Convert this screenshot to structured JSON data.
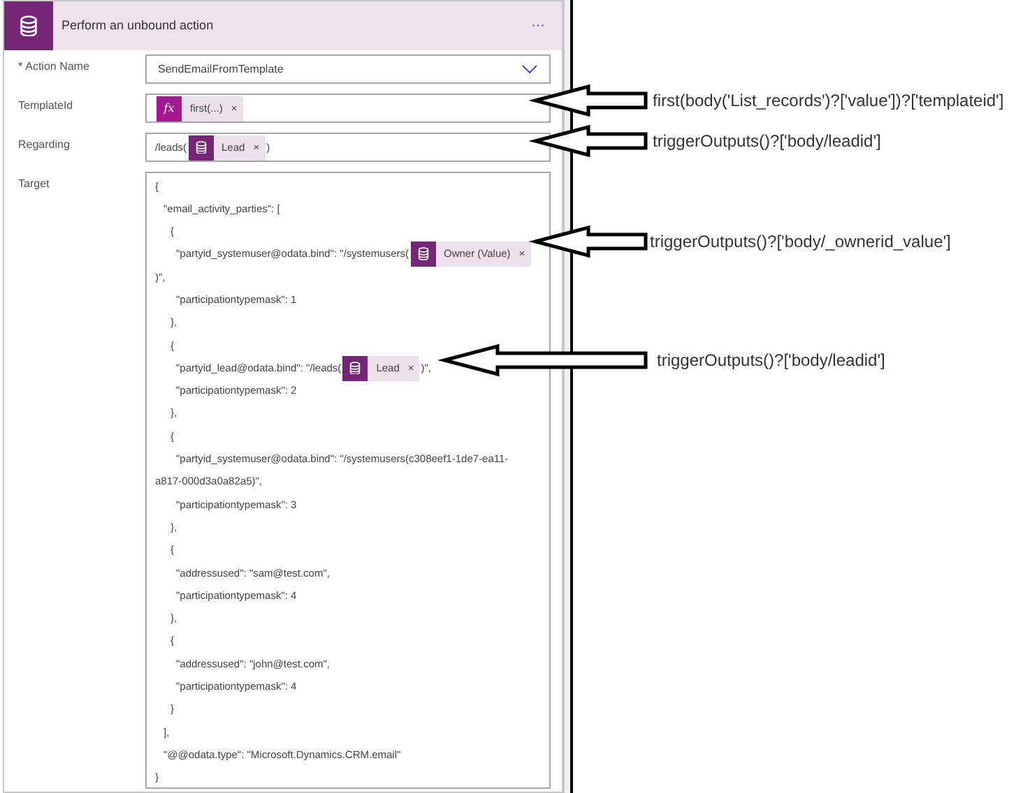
{
  "card": {
    "title": "Perform an unbound action",
    "more": "···"
  },
  "fields": [
    {
      "kind": "select",
      "label": "Action Name",
      "required_mark": "*",
      "value": "SendEmailFromTemplate"
    },
    {
      "kind": "tokens",
      "label": "TemplateId",
      "parts": [
        {
          "kind": "function-token",
          "icon_text": "fx",
          "label": "first(...)",
          "remove": "×"
        }
      ]
    },
    {
      "kind": "tokens",
      "label": "Regarding",
      "parts": [
        {
          "kind": "text",
          "text": "/leads("
        },
        {
          "kind": "entity-token",
          "label": "Lead",
          "remove": "×"
        },
        {
          "kind": "text",
          "text": ")"
        }
      ]
    }
  ],
  "target": {
    "label": "Target",
    "lines": [
      {
        "kind": "line",
        "parts": [
          {
            "kind": "text",
            "text": "{"
          }
        ],
        "children": [
          {
            "kind": "line",
            "parts": [
              {
                "kind": "text",
                "text": "\"email_activity_parties\": ["
              }
            ],
            "children": [
              {
                "kind": "line",
                "parts": [
                  {
                    "kind": "text",
                    "text": "{"
                  }
                ],
                "children": [
                  {
                    "kind": "line",
                    "parts": [
                      {
                        "kind": "text",
                        "text": "\"partyid_systemuser@odata.bind\": \"/systemusers("
                      },
                      {
                        "kind": "entity-token",
                        "label": "Owner (Value)",
                        "remove": "×"
                      }
                    ]
                  },
                  {
                    "kind": "continuation",
                    "parts": [
                      {
                        "kind": "text",
                        "text": ")\","
                      }
                    ]
                  },
                  {
                    "kind": "line",
                    "parts": [
                      {
                        "kind": "text",
                        "text": "\"participationtypemask\": 1"
                      }
                    ]
                  }
                ]
              },
              {
                "kind": "line",
                "parts": [
                  {
                    "kind": "text",
                    "text": "},"
                  }
                ]
              },
              {
                "kind": "line",
                "parts": [
                  {
                    "kind": "text",
                    "text": "{"
                  }
                ],
                "children": [
                  {
                    "kind": "line",
                    "parts": [
                      {
                        "kind": "text",
                        "text": "\"partyid_lead@odata.bind\": \"/leads("
                      },
                      {
                        "kind": "entity-token",
                        "label": "Lead",
                        "remove": "×"
                      },
                      {
                        "kind": "text",
                        "text": ")\","
                      }
                    ]
                  },
                  {
                    "kind": "line",
                    "parts": [
                      {
                        "kind": "text",
                        "text": "\"participationtypemask\": 2"
                      }
                    ]
                  }
                ]
              },
              {
                "kind": "line",
                "parts": [
                  {
                    "kind": "text",
                    "text": "},"
                  }
                ]
              },
              {
                "kind": "line",
                "parts": [
                  {
                    "kind": "text",
                    "text": "{"
                  }
                ],
                "children": [
                  {
                    "kind": "line",
                    "parts": [
                      {
                        "kind": "text",
                        "text": "\"partyid_systemuser@odata.bind\": \"/systemusers(c308eef1-1de7-ea11-"
                      }
                    ]
                  },
                  {
                    "kind": "continuation",
                    "parts": [
                      {
                        "kind": "text",
                        "text": "a817-000d3a0a82a5)\","
                      }
                    ]
                  },
                  {
                    "kind": "line",
                    "parts": [
                      {
                        "kind": "text",
                        "text": "\"participationtypemask\": 3"
                      }
                    ]
                  }
                ]
              },
              {
                "kind": "line",
                "parts": [
                  {
                    "kind": "text",
                    "text": "},"
                  }
                ]
              },
              {
                "kind": "line",
                "parts": [
                  {
                    "kind": "text",
                    "text": "{"
                  }
                ],
                "children": [
                  {
                    "kind": "line",
                    "parts": [
                      {
                        "kind": "text",
                        "text": "\"addressused\": \"sam@test.com\","
                      }
                    ]
                  },
                  {
                    "kind": "line",
                    "parts": [
                      {
                        "kind": "text",
                        "text": "\"participationtypemask\": 4"
                      }
                    ]
                  }
                ]
              },
              {
                "kind": "line",
                "parts": [
                  {
                    "kind": "text",
                    "text": "},"
                  }
                ]
              },
              {
                "kind": "line",
                "parts": [
                  {
                    "kind": "text",
                    "text": "{"
                  }
                ],
                "children": [
                  {
                    "kind": "line",
                    "parts": [
                      {
                        "kind": "text",
                        "text": "\"addressused\": \"john@test.com\","
                      }
                    ]
                  },
                  {
                    "kind": "line",
                    "parts": [
                      {
                        "kind": "text",
                        "text": "\"participationtypemask\": 4"
                      }
                    ]
                  }
                ]
              },
              {
                "kind": "line",
                "parts": [
                  {
                    "kind": "text",
                    "text": "}"
                  }
                ]
              }
            ]
          },
          {
            "kind": "line",
            "parts": [
              {
                "kind": "text",
                "text": "],"
              }
            ]
          },
          {
            "kind": "line",
            "parts": [
              {
                "kind": "text",
                "text": "\"@@odata.type\": \"Microsoft.Dynamics.CRM.email\""
              }
            ]
          }
        ]
      },
      {
        "kind": "line",
        "parts": [
          {
            "kind": "text",
            "text": "}"
          }
        ]
      }
    ]
  },
  "annotations": [
    {
      "text": "first(body('List_records')?['value'])?['templateid']"
    },
    {
      "text": "triggerOutputs()?['body/leadid']"
    },
    {
      "text": "triggerOutputs()?['body/_ownerid_value']"
    },
    {
      "text": "triggerOutputs()?['body/leadid']"
    }
  ]
}
